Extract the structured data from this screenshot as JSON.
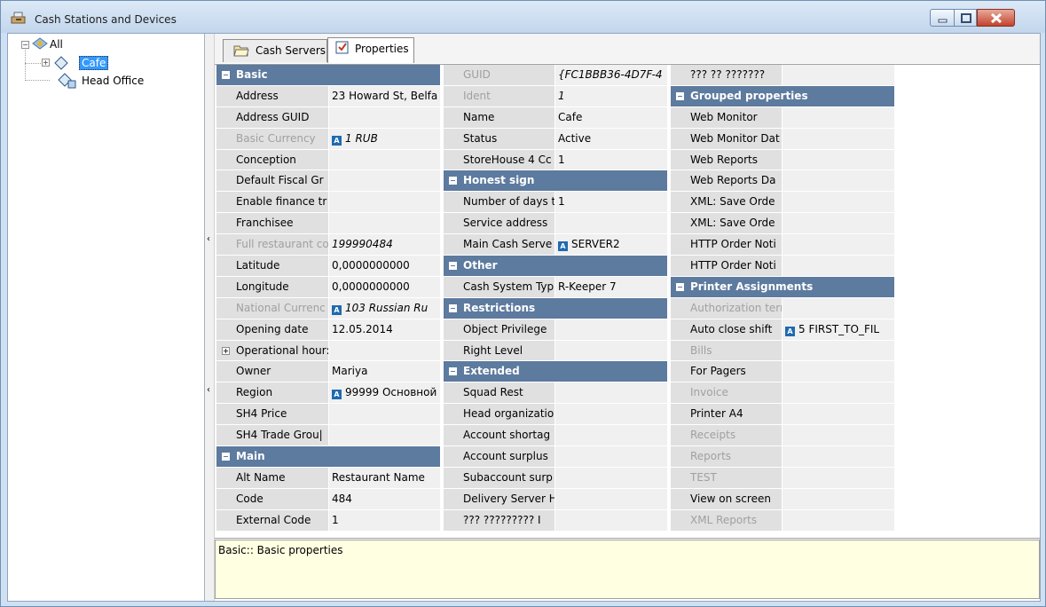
{
  "window": {
    "title": "Cash Stations and Devices"
  },
  "tree": {
    "root": "All",
    "children": [
      "Cafe",
      "Head Office"
    ]
  },
  "tabs": [
    {
      "label": "Cash Servers",
      "active": false
    },
    {
      "label": "Properties",
      "active": true
    }
  ],
  "columns": [
    [
      {
        "type": "cat",
        "label": "Basic"
      },
      {
        "type": "prop",
        "name": "Address",
        "value": "23 Howard St, Belfa"
      },
      {
        "type": "prop",
        "name": "Address GUID",
        "value": ""
      },
      {
        "type": "prop",
        "name": "Basic Currency",
        "value": "1 RUB",
        "ref": true,
        "dim": true,
        "italic": true
      },
      {
        "type": "prop",
        "name": "Conception",
        "value": ""
      },
      {
        "type": "prop",
        "name": "Default Fiscal Gr",
        "value": ""
      },
      {
        "type": "prop",
        "name": "Enable finance tr",
        "value": ""
      },
      {
        "type": "prop",
        "name": "Franchisee",
        "value": ""
      },
      {
        "type": "prop",
        "name": "Full restaurant co",
        "value": "199990484",
        "dim": true,
        "italic": true
      },
      {
        "type": "prop",
        "name": "Latitude",
        "value": "0,0000000000"
      },
      {
        "type": "prop",
        "name": "Longitude",
        "value": "0,0000000000"
      },
      {
        "type": "prop",
        "name": "National Currenc",
        "value": "103 Russian Ru",
        "ref": true,
        "dim": true,
        "italic": true
      },
      {
        "type": "prop",
        "name": "Opening date",
        "value": "12.05.2014"
      },
      {
        "type": "prop",
        "name": "Operational hour:",
        "value": "",
        "expandable": true
      },
      {
        "type": "prop",
        "name": "Owner",
        "value": "Mariya"
      },
      {
        "type": "prop",
        "name": "Region",
        "value": "99999 Основной",
        "ref": true
      },
      {
        "type": "prop",
        "name": "SH4 Price",
        "value": ""
      },
      {
        "type": "prop",
        "name": "SH4 Trade Grou|",
        "value": ""
      },
      {
        "type": "cat",
        "label": "Main"
      },
      {
        "type": "prop",
        "name": "Alt Name",
        "value": "Restaurant Name"
      },
      {
        "type": "prop",
        "name": "Code",
        "value": "484"
      },
      {
        "type": "prop",
        "name": "External Code",
        "value": "1"
      }
    ],
    [
      {
        "type": "prop",
        "name": "GUID",
        "value": "{FC1BBB36-4D7F-4",
        "dim": true,
        "italic": true
      },
      {
        "type": "prop",
        "name": "Ident",
        "value": "1",
        "dim": true,
        "italic": true
      },
      {
        "type": "prop",
        "name": "Name",
        "value": "Cafe"
      },
      {
        "type": "prop",
        "name": "Status",
        "value": "Active"
      },
      {
        "type": "prop",
        "name": "StoreHouse 4 Cc",
        "value": "1"
      },
      {
        "type": "cat",
        "label": "Honest sign"
      },
      {
        "type": "prop",
        "name": "Number of days t",
        "value": "1"
      },
      {
        "type": "prop",
        "name": "Service address",
        "value": ""
      },
      {
        "type": "prop",
        "name": "Main Cash Serve",
        "value": "SERVER2",
        "ref": true
      },
      {
        "type": "cat",
        "label": "Other"
      },
      {
        "type": "prop",
        "name": "Cash System Typ",
        "value": "R-Keeper 7"
      },
      {
        "type": "cat",
        "label": "Restrictions"
      },
      {
        "type": "prop",
        "name": "Object Privilege",
        "value": ""
      },
      {
        "type": "prop",
        "name": "Right Level",
        "value": ""
      },
      {
        "type": "cat",
        "label": "Extended"
      },
      {
        "type": "prop",
        "name": "Squad Rest",
        "value": ""
      },
      {
        "type": "prop",
        "name": "Head organizatio",
        "value": ""
      },
      {
        "type": "prop",
        "name": "Account shortag",
        "value": ""
      },
      {
        "type": "prop",
        "name": "Account surplus",
        "value": ""
      },
      {
        "type": "prop",
        "name": "Subaccount surp",
        "value": ""
      },
      {
        "type": "prop",
        "name": "Delivery Server H",
        "value": ""
      },
      {
        "type": "prop",
        "name": "??? ????????? I",
        "value": ""
      }
    ],
    [
      {
        "type": "prop",
        "name": "??? ?? ???????",
        "value": ""
      },
      {
        "type": "cat",
        "label": "Grouped properties"
      },
      {
        "type": "prop",
        "name": "Web Monitor",
        "value": ""
      },
      {
        "type": "prop",
        "name": "Web Monitor Dat",
        "value": ""
      },
      {
        "type": "prop",
        "name": "Web Reports",
        "value": ""
      },
      {
        "type": "prop",
        "name": "Web Reports Da",
        "value": ""
      },
      {
        "type": "prop",
        "name": "XML: Save Orde",
        "value": ""
      },
      {
        "type": "prop",
        "name": "XML: Save Orde",
        "value": ""
      },
      {
        "type": "prop",
        "name": "HTTP Order Noti",
        "value": ""
      },
      {
        "type": "prop",
        "name": "HTTP Order Noti",
        "value": ""
      },
      {
        "type": "cat",
        "label": "Printer Assignments"
      },
      {
        "type": "prop",
        "name": "Authorization terr",
        "value": "",
        "dim": true
      },
      {
        "type": "prop",
        "name": "Auto close shift",
        "value": "5 FIRST_TO_FIL",
        "ref": true
      },
      {
        "type": "prop",
        "name": "Bills",
        "value": "",
        "dim": true
      },
      {
        "type": "prop",
        "name": "For Pagers",
        "value": ""
      },
      {
        "type": "prop",
        "name": "Invoice",
        "value": "",
        "dim": true
      },
      {
        "type": "prop",
        "name": "Printer A4",
        "value": ""
      },
      {
        "type": "prop",
        "name": "Receipts",
        "value": "",
        "dim": true
      },
      {
        "type": "prop",
        "name": "Reports",
        "value": "",
        "dim": true
      },
      {
        "type": "prop",
        "name": "TEST",
        "value": "",
        "dim": true
      },
      {
        "type": "prop",
        "name": "View on screen",
        "value": ""
      },
      {
        "type": "prop",
        "name": "XML Reports",
        "value": "",
        "dim": true
      }
    ]
  ],
  "description": "Basic:: Basic properties",
  "colors": {
    "category": "#5d7a9f",
    "nameCell": "#e0e0e0",
    "valueCell": "#f0f0f0",
    "description": "#ffffe1"
  }
}
